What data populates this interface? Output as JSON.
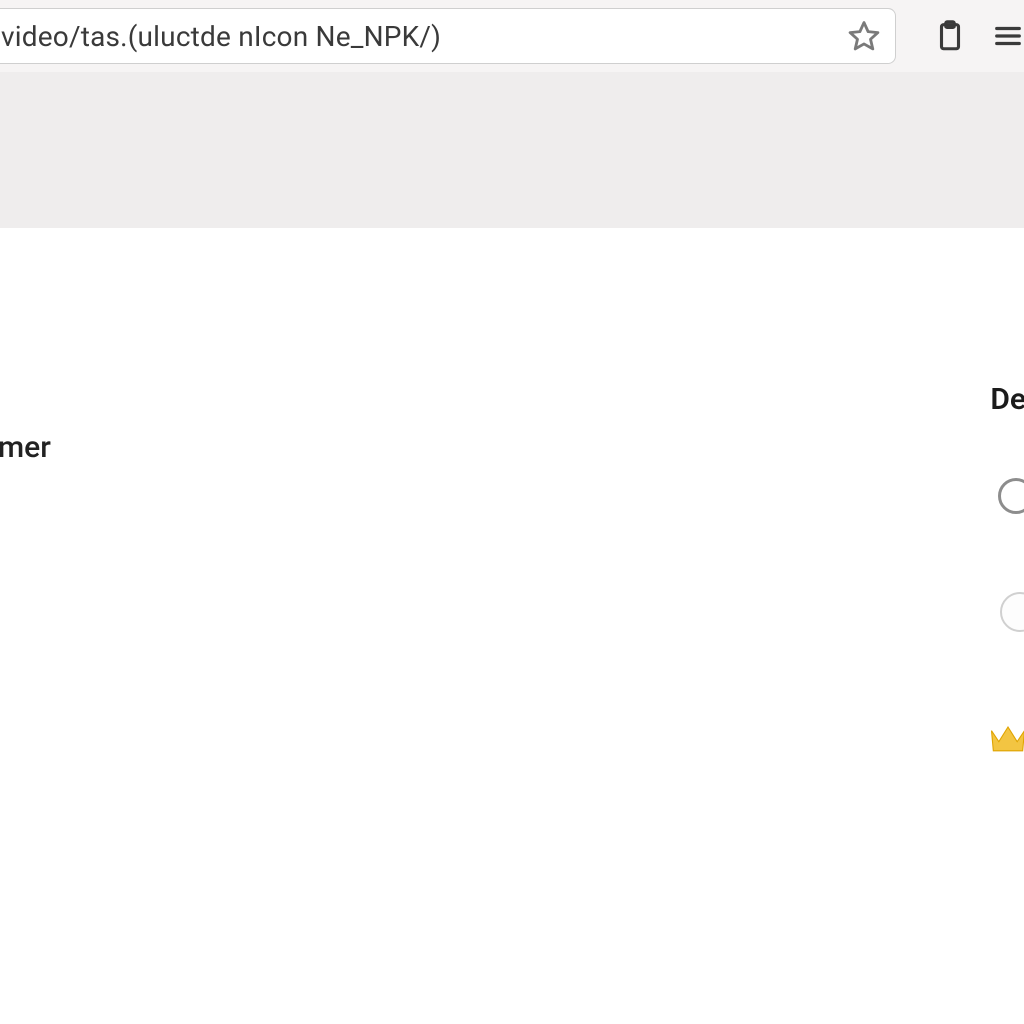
{
  "browser": {
    "url_text": "video/tas.(uluctde nIcon Ne_NPK/)",
    "star_icon": "star-outline-icon",
    "clipboard_icon": "clipboard-icon",
    "menu_icon": "menu-icon"
  },
  "page": {
    "left_fragment": "mer",
    "right_heading": "De",
    "circle_icon": "radio-empty-icon",
    "pill_icon": "pill-icon",
    "crown_icon": "crown-icon"
  },
  "colors": {
    "chrome_bg": "#f6f4f4",
    "grey_band": "#efeded",
    "text": "#3a3a3a",
    "crown": "#f3c542"
  }
}
